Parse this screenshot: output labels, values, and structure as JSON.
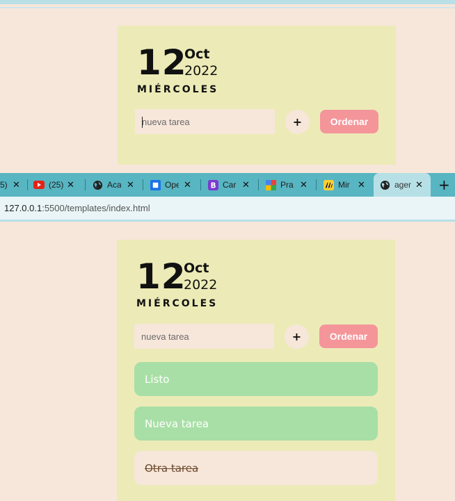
{
  "top_card": {
    "day": "12",
    "month": "Oct",
    "year": "2022",
    "weekday": "MIÉRCOLES",
    "input_placeholder": "nueva tarea",
    "add_label": "+",
    "order_label": "Ordenar"
  },
  "browser": {
    "tabs": [
      {
        "title": "5)",
        "icon": "partial-tab"
      },
      {
        "title": "(25)",
        "icon": "youtube-icon"
      },
      {
        "title": "Aca",
        "icon": "globe-icon"
      },
      {
        "title": "Ope",
        "icon": "app-icon"
      },
      {
        "title": "Car",
        "icon": "b-icon"
      },
      {
        "title": "Pra",
        "icon": "colorful-icon"
      },
      {
        "title": "Mir",
        "icon": "miro-icon"
      },
      {
        "title": "agen",
        "icon": "globe-icon",
        "active": true
      }
    ],
    "close_label": "✕",
    "new_tab_label": "+",
    "url_host": "127.0.0.1",
    "url_rest": ":5500/templates/index.html"
  },
  "bottom_card": {
    "day": "12",
    "month": "Oct",
    "year": "2022",
    "weekday": "MIÉRCOLES",
    "input_placeholder": "nueva tarea",
    "add_label": "+",
    "order_label": "Ordenar",
    "tasks": [
      {
        "label": "Listo",
        "state": "done"
      },
      {
        "label": "Nueva tarea",
        "state": "done"
      },
      {
        "label": "Otra tarea",
        "state": "crossed"
      }
    ]
  },
  "colors": {
    "background": "#f7e6da",
    "card": "#ecebb7",
    "order_button": "#f4959a",
    "task_done": "#a8dfa6",
    "tab_bar": "#58b5c2"
  }
}
